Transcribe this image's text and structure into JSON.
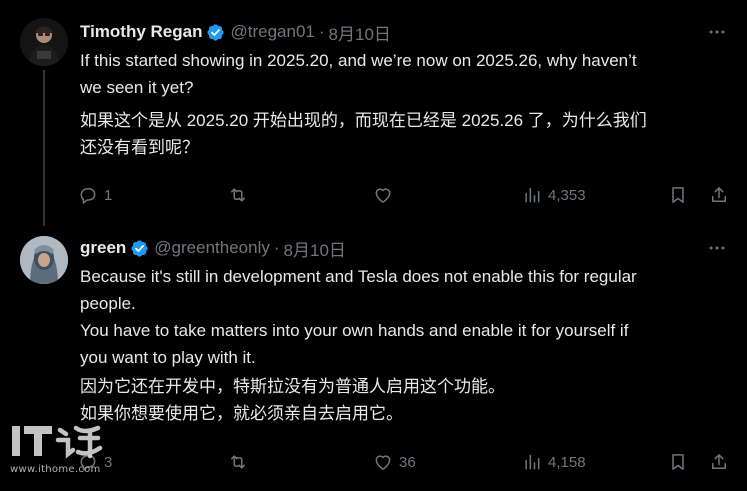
{
  "tweets": [
    {
      "author": {
        "display_name": "Timothy Regan",
        "handle": "@tregan01",
        "verified": true
      },
      "separator": "·",
      "date": "8月10日",
      "text_en": [
        "If this started showing in 2025.20, and we’re now on 2025.26, why haven’t",
        "we seen it yet?"
      ],
      "text_zh": [
        "如果这个是从 2025.20 开始出现的，而现在已经是 2025.26 了，为什么我们",
        "还没有看到呢？"
      ],
      "stats": {
        "replies": "1",
        "reposts": "",
        "likes": "",
        "views": "4,353"
      },
      "icons": {
        "avatar": "avatar-dark-shirt",
        "more": "more-horizontal-icon"
      }
    },
    {
      "author": {
        "display_name": "green",
        "handle": "@greentheonly",
        "verified": true
      },
      "separator": "·",
      "date": "8月10日",
      "text_en": [
        "Because it's still in development and Tesla does not enable this for regular",
        "people.",
        "You have to take matters into your own hands and enable it for yourself if",
        "you want to play with it."
      ],
      "text_zh": [
        "因为它还在开发中，特斯拉没有为普通人启用这个功能。",
        "如果你想要使用它，就必须亲自去启用它。"
      ],
      "stats": {
        "replies": "3",
        "reposts": "",
        "likes": "36",
        "views": "4,158"
      },
      "icons": {
        "avatar": "avatar-robot-helmet",
        "more": "more-horizontal-icon"
      }
    }
  ],
  "watermark": {
    "logo_text": "IT之家",
    "url": "www.ithome.com"
  },
  "colors": {
    "background": "#000000",
    "text": "#e7e9ea",
    "muted": "#71767b",
    "verified": "#1d9bf0",
    "thread_line": "#333639"
  }
}
